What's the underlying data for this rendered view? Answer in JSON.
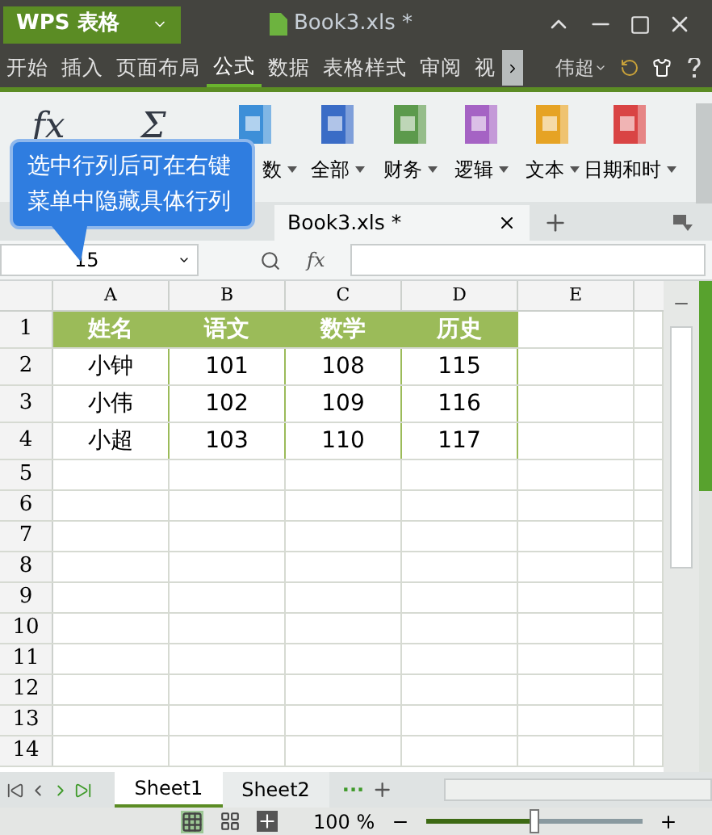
{
  "app": {
    "menu_label": "WPS 表格",
    "title": "Book3.xls *"
  },
  "menu": [
    {
      "label": "开始",
      "selected": false
    },
    {
      "label": "插入",
      "selected": false
    },
    {
      "label": "页面布局",
      "selected": false
    },
    {
      "label": "公式",
      "selected": true
    },
    {
      "label": "数据",
      "selected": false
    },
    {
      "label": "表格样式",
      "selected": false
    },
    {
      "label": "审阅",
      "selected": false
    },
    {
      "label": "视",
      "selected": false
    }
  ],
  "user": "伟超",
  "ribbon": [
    {
      "kind": "glyph",
      "glyph": "fx"
    },
    {
      "kind": "glyph",
      "glyph": "Σ"
    },
    {
      "kind": "book",
      "color": "#3d8fd8",
      "label": "数"
    },
    {
      "kind": "book",
      "color": "#3a6cc6",
      "label": "全部"
    },
    {
      "kind": "book",
      "color": "#5c9a4c",
      "label": "财务"
    },
    {
      "kind": "book",
      "color": "#a563c4",
      "label": "逻辑"
    },
    {
      "kind": "book",
      "color": "#e6a324",
      "label": "文本"
    },
    {
      "kind": "book",
      "color": "#d94444",
      "label": "日期和时"
    }
  ],
  "tooltip": {
    "lines": [
      "选中行列后可在右键",
      "菜单中隐藏具体行列"
    ]
  },
  "doc_tab": {
    "title": "Book3.xls *"
  },
  "formula_bar": {
    "name_box": "15",
    "fx": "fx"
  },
  "columns": [
    "A",
    "B",
    "C",
    "D",
    "E"
  ],
  "rows": [
    {
      "number": "1",
      "cells": [
        "姓名",
        "语文",
        "数学",
        "历史"
      ]
    },
    {
      "number": "2",
      "cells": [
        "小钟",
        "101",
        "108",
        "115"
      ]
    },
    {
      "number": "3",
      "cells": [
        "小伟",
        "102",
        "109",
        "116"
      ]
    },
    {
      "number": "4",
      "cells": [
        "小超",
        "103",
        "110",
        "117"
      ]
    },
    {
      "number": "5"
    },
    {
      "number": "6"
    },
    {
      "number": "7"
    },
    {
      "number": "8"
    },
    {
      "number": "9"
    },
    {
      "number": "10"
    },
    {
      "number": "11"
    },
    {
      "number": "12"
    },
    {
      "number": "13"
    },
    {
      "number": "14"
    }
  ],
  "sheets": [
    {
      "label": "Sheet1",
      "selected": true
    },
    {
      "label": "Sheet2",
      "selected": false
    }
  ],
  "more_sheets": "···",
  "status": {
    "zoom": "100 %",
    "level": 0.5
  }
}
